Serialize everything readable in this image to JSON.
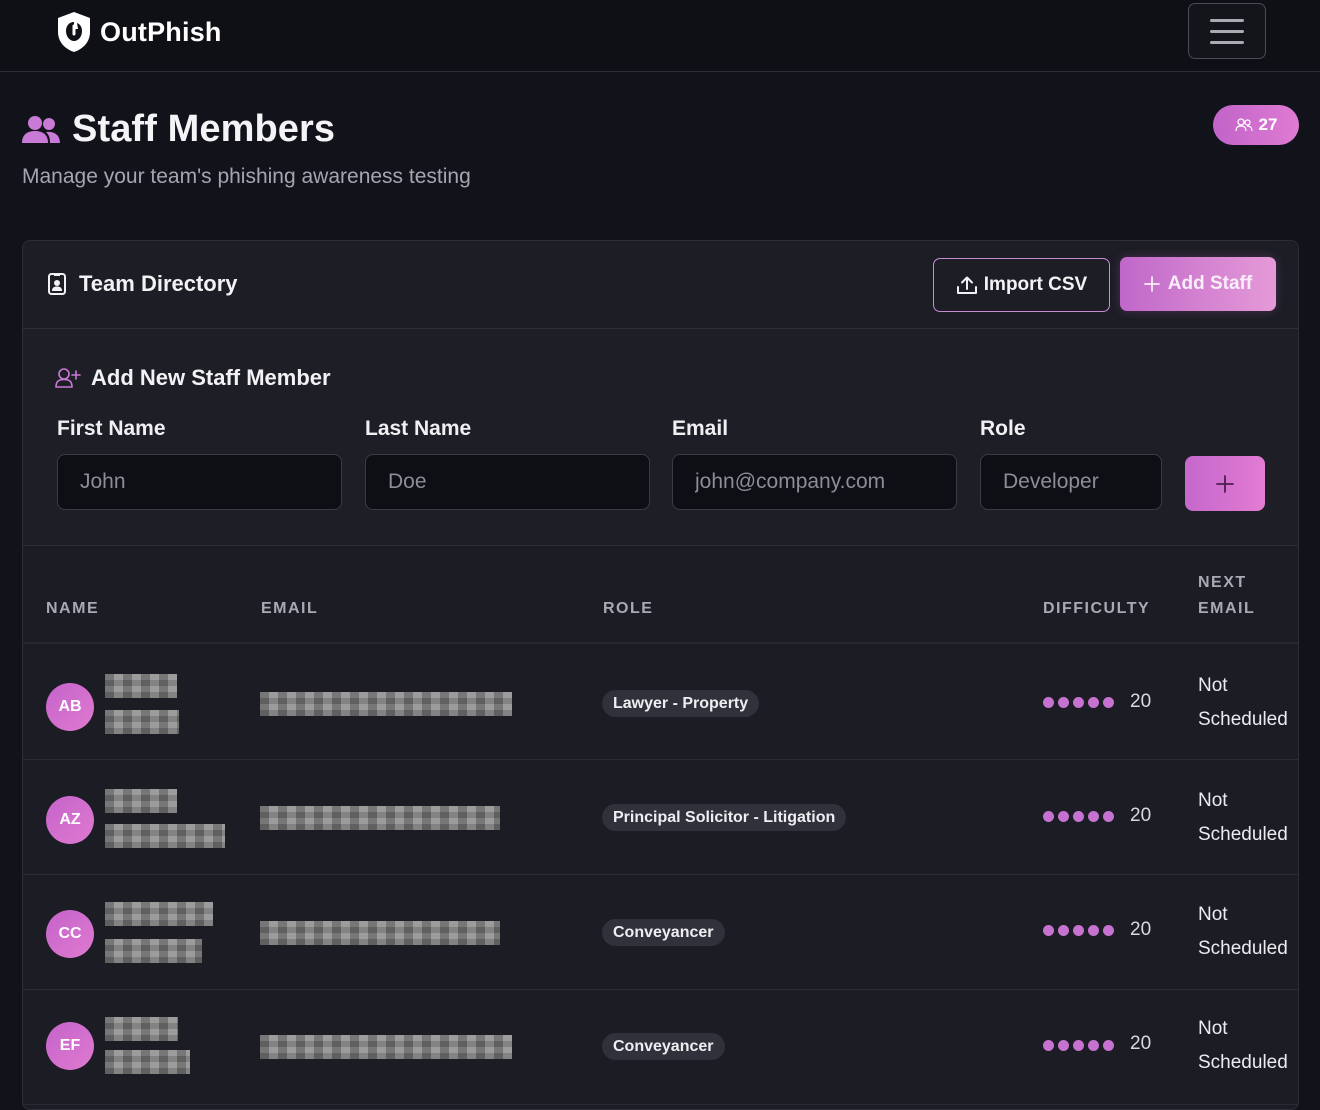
{
  "app": {
    "name": "OutPhish"
  },
  "header": {
    "title": "Staff Members",
    "subtitle": "Manage your team's phishing awareness testing",
    "count": "27"
  },
  "card": {
    "title": "Team Directory",
    "import_label": "Import CSV",
    "add_label": "Add Staff"
  },
  "form": {
    "title": "Add New Staff Member",
    "fields": [
      {
        "label": "First Name",
        "placeholder": "John"
      },
      {
        "label": "Last Name",
        "placeholder": "Doe"
      },
      {
        "label": "Email",
        "placeholder": "john@company.com"
      },
      {
        "label": "Role",
        "placeholder": "Developer"
      }
    ],
    "submit_icon": "plus-icon"
  },
  "table": {
    "columns": [
      "NAME",
      "EMAIL",
      "ROLE",
      "DIFFICULTY",
      "NEXT",
      "EMAIL"
    ],
    "rows": [
      {
        "initials": "AB",
        "role": "Lawyer - Property",
        "difficulty": "20",
        "difficulty_level": 5,
        "next_1": "Not",
        "next_2": "Scheduled"
      },
      {
        "initials": "AZ",
        "role": "Principal Solicitor - Litigation",
        "difficulty": "20",
        "difficulty_level": 5,
        "next_1": "Not",
        "next_2": "Scheduled"
      },
      {
        "initials": "CC",
        "role": "Conveyancer",
        "difficulty": "20",
        "difficulty_level": 5,
        "next_1": "Not",
        "next_2": "Scheduled"
      },
      {
        "initials": "EF",
        "role": "Conveyancer",
        "difficulty": "20",
        "difficulty_level": 5,
        "next_1": "Not",
        "next_2": "Scheduled"
      }
    ]
  },
  "colors": {
    "accent": "#d070d0",
    "background": "#12131a",
    "card": "#1b1c24"
  }
}
